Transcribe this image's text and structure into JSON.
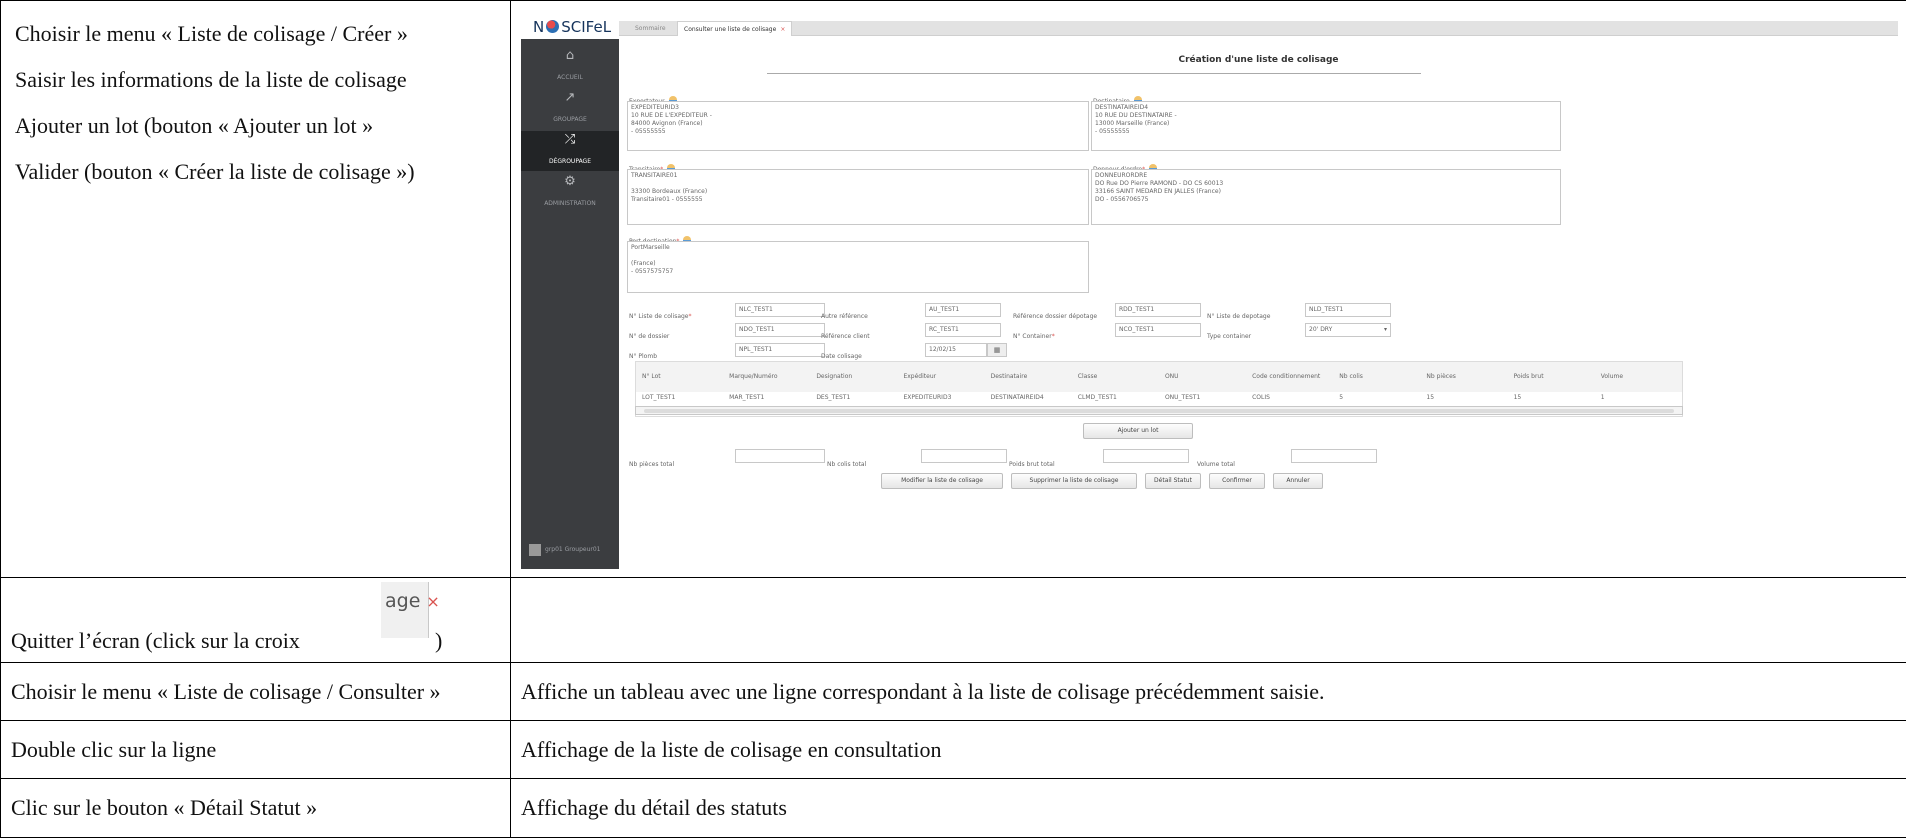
{
  "steps": [
    "Choisir le menu « Liste de colisage / Créer »",
    "Saisir les informations de la liste de colisage",
    "Ajouter un lot (bouton « Ajouter un lot »",
    "Valider (bouton « Créer la liste de colisage »)"
  ],
  "app": {
    "logo_text": "N",
    "logo_text2": "SCIFeL",
    "sidebar": [
      {
        "icon": "⌂",
        "label": "ACCUEIL"
      },
      {
        "icon": "↗",
        "label": "GROUPAGE"
      },
      {
        "icon": "⤮",
        "label": "DÉGROUPAGE"
      },
      {
        "icon": "⚙",
        "label": "ADMINISTRATION"
      }
    ],
    "user_name": "grp01",
    "user_role": "Groupeur01",
    "tabs": {
      "tab1": "Sommaire",
      "tab2": "Consulter une liste de colisage",
      "close": "×"
    },
    "form_title": "Création d'une liste de colisage",
    "exportateur_label": "Exportateur",
    "exportateur_value": "EXPEDITEURID3\n10 RUE DE L'EXPEDITEUR -\n84000 Avignon (France)\n- 05555555",
    "destinataire_label": "Destinataire",
    "destinataire_value": "DESTINATAIREID4\n10 RUE DU DESTINATAIRE -\n13000 Marseille (France)\n- 05555555",
    "transitaire_label": "Transitaire",
    "transitaire_value": "TRANSITAIRE01\n\n33300 Bordeaux (France)\nTransitaire01 - 0555555",
    "donneur_label": "Donneur d'ordre",
    "donneur_value": "DONNEURORDRE\nDO Rue DO Pierre RAMOND - DO CS 60013\n33166 SAINT MEDARD EN JALLES (France)\nDO - 0556706575",
    "port_label": "Port destination",
    "port_value": "PortMarseille\n\n(France)\n- 0557575757",
    "fields": {
      "nlc_label": "N° Liste de colisage",
      "nlc_value": "NLC_TEST1",
      "autre_label": "Autre référence",
      "autre_value": "AU_TEST1",
      "rdd_label": "Référence dossier dépotage",
      "rdd_value": "RDD_TEST1",
      "nld_label": "N° Liste de depotage",
      "nld_value": "NLD_TEST1",
      "ndo_label": "N° de dossier",
      "ndo_value": "NDO_TEST1",
      "rc_label": "Référence client",
      "rc_value": "RC_TEST1",
      "nco_label": "N° Container",
      "nco_value": "NCO_TEST1",
      "type_label": "Type container",
      "type_value": "20' DRY",
      "npl_label": "N° Plomb",
      "npl_value": "NPL_TEST1",
      "date_label": "Date colisage",
      "date_value": "12/02/15"
    },
    "grid_headers": [
      "N° Lot",
      "Marque/Numéro",
      "Designation",
      "Expéditeur",
      "Destinataire",
      "Classe",
      "ONU",
      "Code conditionnement",
      "Nb colis",
      "Nb pièces",
      "Poids brut",
      "Volume"
    ],
    "grid_row": [
      "LOT_TEST1",
      "MAR_TEST1",
      "DES_TEST1",
      "EXPEDITEURID3",
      "DESTINATAIREID4",
      "CLMD_TEST1",
      "ONU_TEST1",
      "COLIS",
      "5",
      "15",
      "15",
      "1"
    ],
    "add_lot": "Ajouter un lot",
    "totals": {
      "pieces": "Nb pièces total",
      "colis": "Nb colis total",
      "poids": "Poids brut total",
      "volume": "Volume total"
    },
    "buttons": [
      "Modifier la liste de colisage",
      "Supprimer la liste de colisage",
      "Détail Statut",
      "Confirmer",
      "Annuler"
    ]
  },
  "quit_step": "Quitter l’écran (click sur la croix",
  "quit_close": ")",
  "croix_text": "age",
  "croix_x": "×",
  "rows": [
    {
      "action": "Choisir le menu « Liste de colisage / Consulter »",
      "result": "Affiche un tableau avec une ligne correspondant à la liste de colisage précédemment saisie."
    },
    {
      "action": "Double clic sur la ligne",
      "result": "Affichage de la liste de colisage en consultation"
    },
    {
      "action": "Clic sur le bouton « Détail Statut »",
      "result": "Affichage du détail des statuts"
    }
  ]
}
